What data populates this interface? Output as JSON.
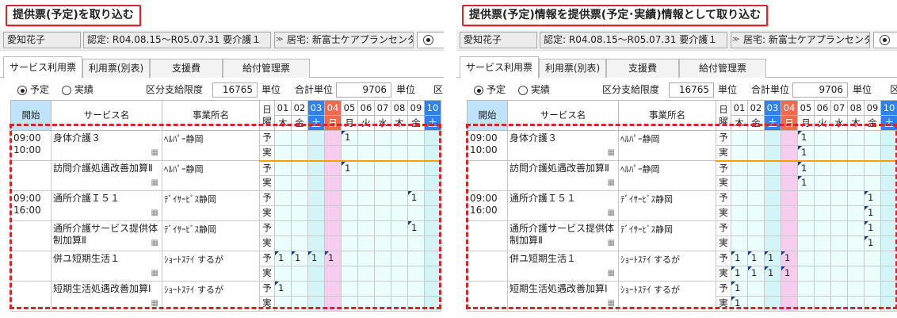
{
  "left": {
    "title": "提供票(予定)を取り込む",
    "patient": "愛知花子",
    "cert": "認定: R04.08.15～R05.07.31 要介護１",
    "office_chevron": "≫",
    "office": "居宅: 新富士ケアプランセンター",
    "tabs": [
      "サービス利用票",
      "利用票(別表)",
      "支援費",
      "給付管理票"
    ],
    "radio_yotei": "予定",
    "radio_jisseki": "実績",
    "limit_label": "区分支給限度",
    "limit_value": "16765",
    "limit_unit": "単位",
    "total_label": "合計単位",
    "total_value": "9706",
    "total_unit": "単位",
    "trailing_label": "区分",
    "headers": {
      "start": "開始",
      "service": "サービス名",
      "office": "事業所名",
      "weekday_label": "日曜"
    },
    "dates": [
      {
        "d": "01",
        "w": "木",
        "style": ""
      },
      {
        "d": "02",
        "w": "金",
        "style": ""
      },
      {
        "d": "03",
        "w": "土",
        "style": "bl"
      },
      {
        "d": "04",
        "w": "日",
        "style": "rd"
      },
      {
        "d": "05",
        "w": "月",
        "style": ""
      },
      {
        "d": "06",
        "w": "火",
        "style": ""
      },
      {
        "d": "07",
        "w": "水",
        "style": ""
      },
      {
        "d": "08",
        "w": "木",
        "style": ""
      },
      {
        "d": "09",
        "w": "金",
        "style": ""
      },
      {
        "d": "10",
        "w": "土",
        "style": "bl"
      }
    ],
    "services": [
      {
        "start": "09:00",
        "end": "10:00",
        "name": "身体介護３",
        "office": "ﾍﾙﾊﾟｰ静岡",
        "kinds": [
          "予",
          "実"
        ],
        "cells": [
          [
            "",
            "",
            "",
            "",
            "1",
            "",
            "",
            "",
            "",
            ""
          ],
          [
            "",
            "",
            "",
            "",
            "",
            "",
            "",
            "",
            "",
            ""
          ]
        ],
        "orange": true
      },
      {
        "start": "",
        "end": "",
        "name": "訪問介護処遇改善加算Ⅱ",
        "office": "ﾍﾙﾊﾟｰ静岡",
        "kinds": [
          "予",
          "実"
        ],
        "cells": [
          [
            "",
            "",
            "",
            "",
            "1",
            "",
            "",
            "",
            "",
            ""
          ],
          [
            "",
            "",
            "",
            "",
            "",
            "",
            "",
            "",
            "",
            ""
          ]
        ]
      },
      {
        "start": "09:00",
        "end": "16:00",
        "name": "通所介護Ｉ５１",
        "office": "ﾃﾞｲｻｰﾋﾞｽ静岡",
        "kinds": [
          "予",
          "実"
        ],
        "cells": [
          [
            "",
            "",
            "",
            "",
            "",
            "",
            "",
            "",
            "1",
            ""
          ],
          [
            "",
            "",
            "",
            "",
            "",
            "",
            "",
            "",
            "",
            ""
          ]
        ]
      },
      {
        "start": "",
        "end": "",
        "name": "通所介護サービス提供体制加算Ⅱ",
        "office": "ﾃﾞｲｻｰﾋﾞｽ静岡",
        "kinds": [
          "予",
          "実"
        ],
        "cells": [
          [
            "",
            "",
            "",
            "",
            "",
            "",
            "",
            "",
            "1",
            ""
          ],
          [
            "",
            "",
            "",
            "",
            "",
            "",
            "",
            "",
            "",
            ""
          ]
        ]
      },
      {
        "start": "",
        "end": "",
        "name": "併ユ短期生活１",
        "office": "ｼｮｰﾄｽﾃｲ するが",
        "kinds": [
          "予",
          "実"
        ],
        "cells": [
          [
            "1",
            "1",
            "1",
            "1",
            "",
            "",
            "",
            "",
            "",
            ""
          ],
          [
            "",
            "",
            "",
            "",
            "",
            "",
            "",
            "",
            "",
            ""
          ]
        ]
      },
      {
        "start": "",
        "end": "",
        "name": "短期生活処遇改善加算Ⅰ",
        "office": "ｼｮｰﾄｽﾃｲ するが",
        "kinds": [
          "予",
          "実"
        ],
        "cells": [
          [
            "1",
            "",
            "",
            "",
            "",
            "",
            "",
            "",
            "",
            ""
          ],
          [
            "",
            "",
            "",
            "",
            "",
            "",
            "",
            "",
            "",
            ""
          ]
        ]
      }
    ]
  },
  "right": {
    "title": "提供票(予定)情報を提供票(予定･実績)情報として取り込む",
    "patient": "愛知花子",
    "cert": "認定: R04.08.15～R05.07.31 要介護１",
    "office_chevron": "≫",
    "office": "居宅: 新富士ケアプランセンター",
    "tabs": [
      "サービス利用票",
      "利用票(別表)",
      "支援費",
      "給付管理票"
    ],
    "radio_yotei": "予定",
    "radio_jisseki": "実績",
    "limit_label": "区分支給限度",
    "limit_value": "16765",
    "limit_unit": "単位",
    "total_label": "合計単位",
    "total_value": "9706",
    "total_unit": "単位",
    "trailing_label": "区分",
    "headers": {
      "start": "開始",
      "service": "サービス名",
      "office": "事業所名",
      "weekday_label": "日曜"
    },
    "dates": [
      {
        "d": "01",
        "w": "木",
        "style": ""
      },
      {
        "d": "02",
        "w": "金",
        "style": ""
      },
      {
        "d": "03",
        "w": "土",
        "style": "bl"
      },
      {
        "d": "04",
        "w": "日",
        "style": "rd"
      },
      {
        "d": "05",
        "w": "月",
        "style": ""
      },
      {
        "d": "06",
        "w": "火",
        "style": ""
      },
      {
        "d": "07",
        "w": "水",
        "style": ""
      },
      {
        "d": "08",
        "w": "木",
        "style": ""
      },
      {
        "d": "09",
        "w": "金",
        "style": ""
      },
      {
        "d": "10",
        "w": "土",
        "style": "bl"
      }
    ],
    "services": [
      {
        "start": "09:00",
        "end": "10:00",
        "name": "身体介護３",
        "office": "ﾍﾙﾊﾟｰ静岡",
        "kinds": [
          "予",
          "実"
        ],
        "cells": [
          [
            "",
            "",
            "",
            "",
            "1",
            "",
            "",
            "",
            "",
            ""
          ],
          [
            "",
            "",
            "",
            "",
            "1",
            "",
            "",
            "",
            "",
            ""
          ]
        ],
        "orange": true
      },
      {
        "start": "",
        "end": "",
        "name": "訪問介護処遇改善加算Ⅱ",
        "office": "ﾍﾙﾊﾟｰ静岡",
        "kinds": [
          "予",
          "実"
        ],
        "cells": [
          [
            "",
            "",
            "",
            "",
            "1",
            "",
            "",
            "",
            "",
            ""
          ],
          [
            "",
            "",
            "",
            "",
            "1",
            "",
            "",
            "",
            "",
            ""
          ]
        ]
      },
      {
        "start": "09:00",
        "end": "16:00",
        "name": "通所介護Ｉ５１",
        "office": "ﾃﾞｲｻｰﾋﾞｽ静岡",
        "kinds": [
          "予",
          "実"
        ],
        "cells": [
          [
            "",
            "",
            "",
            "",
            "",
            "",
            "",
            "",
            "1",
            ""
          ],
          [
            "",
            "",
            "",
            "",
            "",
            "",
            "",
            "",
            "1",
            ""
          ]
        ]
      },
      {
        "start": "",
        "end": "",
        "name": "通所介護サービス提供体制加算Ⅱ",
        "office": "ﾃﾞｲｻｰﾋﾞｽ静岡",
        "kinds": [
          "予",
          "実"
        ],
        "cells": [
          [
            "",
            "",
            "",
            "",
            "",
            "",
            "",
            "",
            "1",
            ""
          ],
          [
            "",
            "",
            "",
            "",
            "",
            "",
            "",
            "",
            "1",
            ""
          ]
        ]
      },
      {
        "start": "",
        "end": "",
        "name": "併ユ短期生活１",
        "office": "ｼｮｰﾄｽﾃｲ するが",
        "kinds": [
          "予",
          "実"
        ],
        "cells": [
          [
            "1",
            "1",
            "1",
            "1",
            "",
            "",
            "",
            "",
            "",
            ""
          ],
          [
            "1",
            "1",
            "1",
            "1",
            "",
            "",
            "",
            "",
            "",
            ""
          ]
        ]
      },
      {
        "start": "",
        "end": "",
        "name": "短期生活処遇改善加算Ⅰ",
        "office": "ｼｮｰﾄｽﾃｲ するが",
        "kinds": [
          "予",
          "実"
        ],
        "cells": [
          [
            "1",
            "",
            "",
            "",
            "",
            "",
            "",
            "",
            "",
            ""
          ],
          [
            "1",
            "",
            "",
            "",
            "",
            "",
            "",
            "",
            "",
            ""
          ]
        ]
      }
    ]
  },
  "colors": {
    "frame": "#d5262c",
    "saturday": "#2f81ed",
    "sunday": "#ef6b49",
    "start_header": "#bfe3fb",
    "separator": "#f0a20b"
  },
  "icons": {
    "calendar": "calendar-icon",
    "chevron": "double-chevron-icon"
  }
}
